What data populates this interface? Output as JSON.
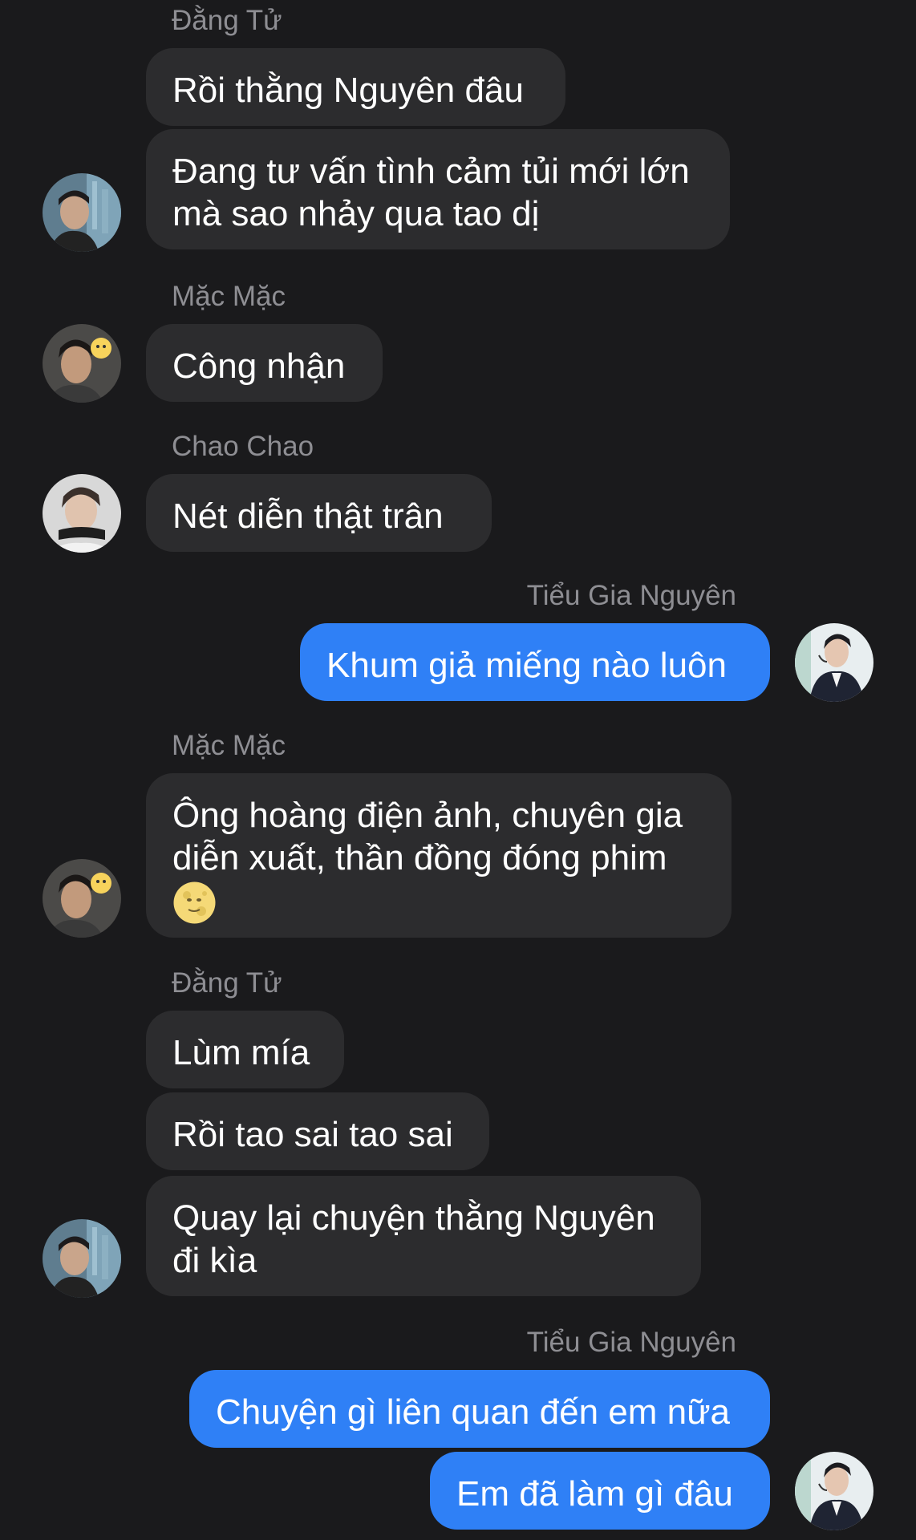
{
  "messages": [
    {
      "sender": "Đằng Tử",
      "texts": [
        "Rồi thằng Nguyên đâu",
        "Đang tư vấn tình cảm tủi mới lớn",
        "mà sao nhảy qua tao dị"
      ]
    },
    {
      "sender": "Mặc Mặc",
      "texts": [
        "Công nhận"
      ]
    },
    {
      "sender": "Chao Chao",
      "texts": [
        "Nét diễn thật trân"
      ]
    },
    {
      "sender": "Tiểu Gia Nguyên",
      "texts": [
        "Khum giả miếng nào luôn"
      ]
    },
    {
      "sender": "Mặc Mặc",
      "texts": [
        "Ông hoàng điện ảnh, chuyên gia",
        "diễn xuất, thần đồng đóng phim"
      ],
      "emoji": "full-moon-face-emoji"
    },
    {
      "sender": "Đằng Tử",
      "texts": [
        "Lùm mía",
        "Rồi tao sai tao sai",
        "Quay lại chuyện thằng Nguyên",
        "đi kìa"
      ]
    },
    {
      "sender": "Tiểu Gia Nguyên",
      "texts": [
        "Chuyện gì liên quan đến em nữa",
        "Em đã làm gì đâu"
      ]
    }
  ],
  "colors": {
    "background": "#1a1a1c",
    "incoming_bubble": "#2c2c2e",
    "outgoing_bubble": "#2f80f6",
    "sender_name": "#8e8e93"
  }
}
